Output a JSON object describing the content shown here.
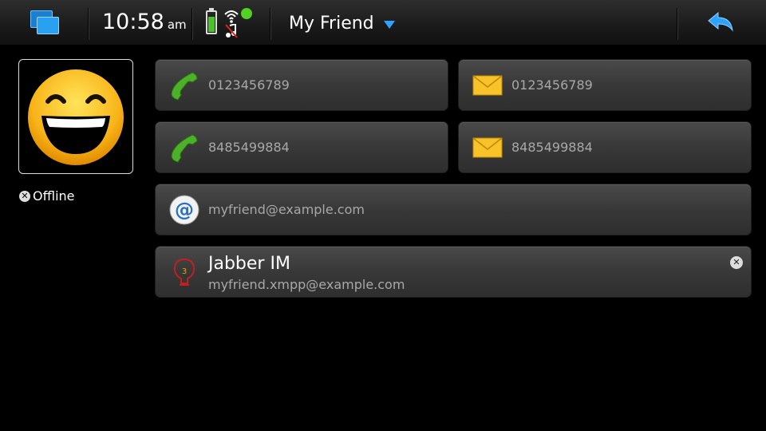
{
  "status_bar": {
    "time": "10:58",
    "ampm": "am",
    "title": "My Friend",
    "icons": {
      "switcher": "task-switcher-icon",
      "battery": "battery-icon",
      "wifi": "wifi-icon",
      "mute": "mute-icon",
      "back": "back-arrow-icon"
    },
    "battery_level": 0.75,
    "accent_color": "#2ea2ff"
  },
  "contact": {
    "presence": "Offline"
  },
  "details": {
    "phones": [
      "0123456789",
      "8485499884"
    ],
    "sms": [
      "0123456789",
      "8485499884"
    ],
    "email": "myfriend@example.com",
    "im": {
      "service": "Jabber IM",
      "address": "myfriend.xmpp@example.com"
    }
  }
}
